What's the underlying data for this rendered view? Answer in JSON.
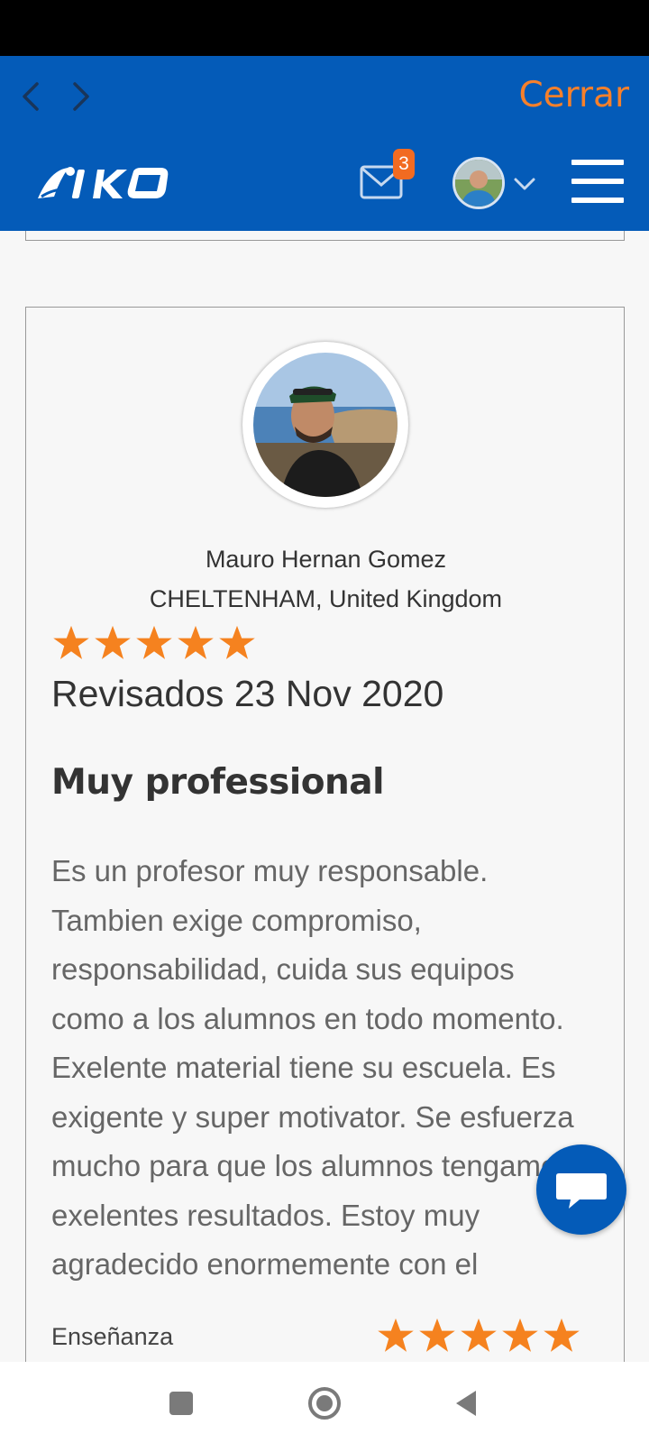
{
  "browser": {
    "close_label": "Cerrar",
    "back_icon": "chevron-left-icon",
    "forward_icon": "chevron-right-icon"
  },
  "header": {
    "logo_text": "IKO",
    "messages_badge": "3",
    "mail_icon": "envelope-icon",
    "menu_icon": "hamburger-icon"
  },
  "review": {
    "reviewer_name": "Mauro Hernan Gomez",
    "reviewer_location": "CHELTENHAM, United Kingdom",
    "rating": 5,
    "date_text": "Revisados 23 Nov 2020",
    "title": "Muy professional",
    "body": "Es un profesor muy responsable. Tambien exige compromiso, responsabilidad, cuida sus equipos como a los alumnos en todo momento. Exelente material tiene su escuela. Es exigente y super motivator. Se esfuerza mucho para que los alumnos tengamos exelentes resultados. Estoy muy agradecido enormemente con el",
    "sub_rating_label": "Enseñanza",
    "sub_rating": 5
  },
  "colors": {
    "brand_blue": "#045bb8",
    "accent_orange": "#f6802b",
    "star_orange": "#f5821f",
    "badge_orange": "#f26b21"
  },
  "system_nav": {
    "recents_icon": "square-icon",
    "home_icon": "home-circle-icon",
    "back_icon": "triangle-back-icon"
  }
}
